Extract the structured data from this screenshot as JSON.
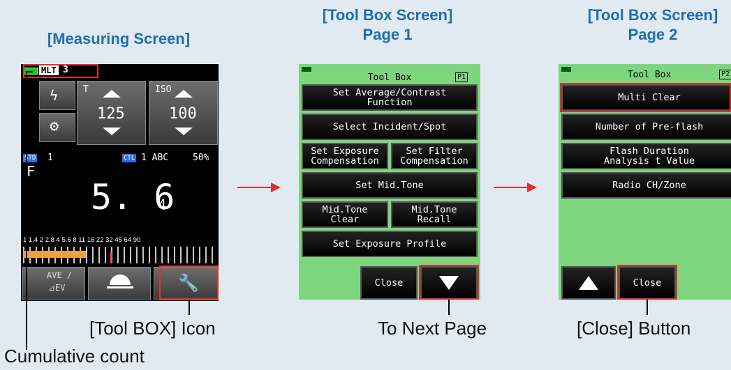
{
  "headings": {
    "measuring": "[Measuring Screen]",
    "toolbox1_line1": "[Tool Box Screen]",
    "toolbox1_line2": "Page 1",
    "toolbox2_line1": "[Tool Box Screen]",
    "toolbox2_line2": "Page 2"
  },
  "captions": {
    "toolbox_icon": "[Tool BOX] Icon",
    "next_page": "To Next Page",
    "close_button": "[Close] Button",
    "cumulative": "Cumulative count"
  },
  "measuring_screen": {
    "mode_badge": "MLT",
    "count": "3",
    "t_label": "T",
    "t_value": "125",
    "iso_label": "ISO",
    "iso_value": "100",
    "std_badge": "STD",
    "std_value": "1",
    "ctl_badge": "CTL",
    "ctl_value": "1 ABC",
    "percent": "50%",
    "f_label": "F",
    "f_main": "5. 6",
    "f_sub": "4",
    "scale_labels": "1 1.4 2 2.8 4 5.6 8 11 16 22 32 45 64 90",
    "ave_label": "AVE /",
    "ev_label": "⊿EV",
    "icons": [
      "battery-icon",
      "flash-icon",
      "gear-icon",
      "dome-icon",
      "wrench-icon"
    ]
  },
  "toolbox_page1": {
    "title": "Tool Box",
    "page_badge": "P1",
    "buttons": {
      "avg_contrast": "Set Average/Contrast\nFunction",
      "incident_spot": "Select Incident/Spot",
      "exposure_comp": "Set Exposure\nCompensation",
      "filter_comp": "Set Filter\nCompensation",
      "mid_tone": "Set Mid.Tone",
      "mid_clear": "Mid.Tone\nClear",
      "mid_recall": "Mid.Tone\nRecall",
      "exposure_profile": "Set Exposure Profile",
      "close": "Close"
    }
  },
  "toolbox_page2": {
    "title": "Tool Box",
    "page_badge": "P2",
    "buttons": {
      "multi_clear": "Multi Clear",
      "pre_flash": "Number of Pre-flash",
      "flash_duration": "Flash Duration\nAnalysis t Value",
      "radio": "Radio CH/Zone",
      "close": "Close"
    }
  },
  "colors": {
    "heading": "#1f6fad",
    "accent_red": "#e0302c",
    "screen_green": "#7dd67d",
    "background": "#e1e9f1"
  }
}
